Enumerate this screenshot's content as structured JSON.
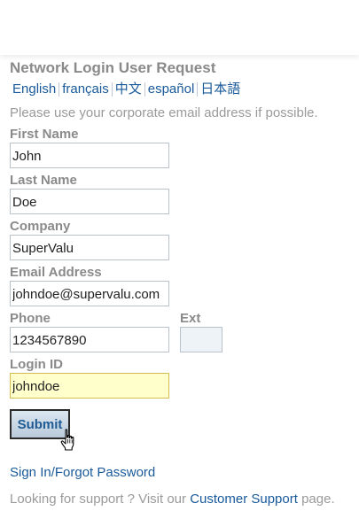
{
  "form": {
    "title": "Network Login User Request",
    "languages": [
      "English",
      "français",
      "中文",
      "español",
      "日本語"
    ],
    "note": "Please use your corporate email address if possible.",
    "fields": {
      "first_name": {
        "label": "First Name",
        "value": "John"
      },
      "last_name": {
        "label": "Last Name",
        "value": "Doe"
      },
      "company": {
        "label": "Company",
        "value": "SuperValu"
      },
      "email": {
        "label": "Email Address",
        "value": "johndoe@supervalu.com"
      },
      "phone": {
        "label": "Phone",
        "value": "1234567890"
      },
      "ext": {
        "label": "Ext",
        "value": ""
      },
      "login_id": {
        "label": "Login ID",
        "value": "johndoe"
      }
    },
    "submit_label": "Submit"
  },
  "links": {
    "signin": "Sign In/Forgot Password",
    "support_prefix": "Looking for support ? Visit our ",
    "support_link": "Customer Support",
    "support_suffix": " page."
  },
  "colors": {
    "link": "#1a5a9a",
    "label": "#8a8a8a",
    "focused_field_bg": "#ffffcc"
  }
}
